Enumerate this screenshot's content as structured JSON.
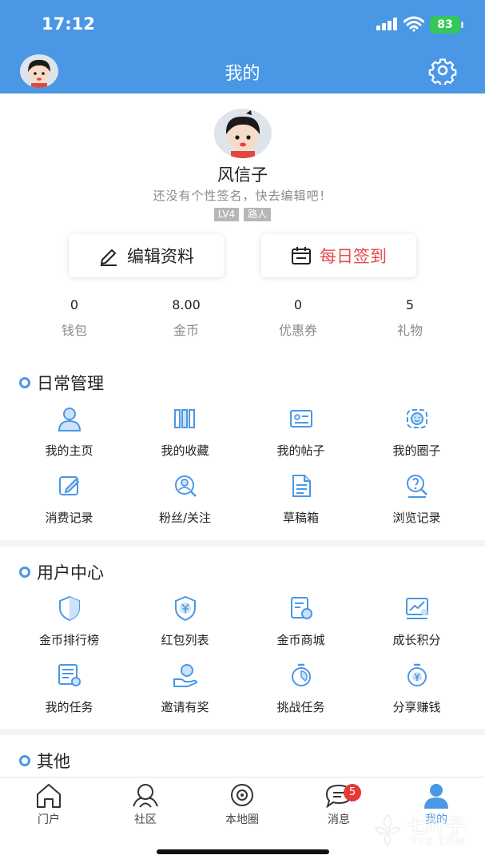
{
  "status_bar": {
    "time": "17:12",
    "battery": "83"
  },
  "nav": {
    "title": "我的",
    "avatar_icon": "cartoon-avatar",
    "settings_icon": "gear-icon"
  },
  "profile": {
    "name": "风信子",
    "signature": "还没有个性签名，快去编辑吧！",
    "level": "LV4",
    "rank": "路人"
  },
  "actions": {
    "edit_label": "编辑资料",
    "signin_label": "每日签到"
  },
  "stats": [
    {
      "value": "0",
      "label": "钱包"
    },
    {
      "value": "8.00",
      "label": "金币"
    },
    {
      "value": "0",
      "label": "优惠券"
    },
    {
      "value": "5",
      "label": "礼物"
    }
  ],
  "sections": {
    "daily": {
      "title": "日常管理",
      "items": [
        {
          "label": "我的主页",
          "icon": "user-icon"
        },
        {
          "label": "我的收藏",
          "icon": "books-icon"
        },
        {
          "label": "我的帖子",
          "icon": "id-card-icon"
        },
        {
          "label": "我的圈子",
          "icon": "smile-face-icon"
        },
        {
          "label": "消费记录",
          "icon": "edit-note-icon"
        },
        {
          "label": "粉丝/关注",
          "icon": "user-search-icon"
        },
        {
          "label": "草稿箱",
          "icon": "document-icon"
        },
        {
          "label": "浏览记录",
          "icon": "search-bulb-icon"
        }
      ]
    },
    "user_center": {
      "title": "用户中心",
      "items": [
        {
          "label": "金币排行榜",
          "icon": "shield-icon"
        },
        {
          "label": "红包列表",
          "icon": "yuan-shield-icon"
        },
        {
          "label": "金币商城",
          "icon": "store-coin-icon"
        },
        {
          "label": "成长积分",
          "icon": "chart-card-icon"
        },
        {
          "label": "我的任务",
          "icon": "task-list-icon"
        },
        {
          "label": "邀请有奖",
          "icon": "gift-hand-icon"
        },
        {
          "label": "挑战任务",
          "icon": "stopwatch-icon"
        },
        {
          "label": "分享赚钱",
          "icon": "coin-timer-icon"
        }
      ]
    },
    "other": {
      "title": "其他"
    }
  },
  "tabbar": [
    {
      "label": "门户",
      "icon": "home-icon"
    },
    {
      "label": "社区",
      "icon": "community-icon"
    },
    {
      "label": "本地圈",
      "icon": "local-circle-icon"
    },
    {
      "label": "消息",
      "icon": "chat-icon",
      "badge": "5"
    },
    {
      "label": "我的",
      "icon": "profile-icon",
      "active": true
    }
  ],
  "watermark": {
    "text": "七叶子",
    "sub": "7YZ.COM"
  },
  "colors": {
    "accent": "#4a97e6",
    "signin": "#e54b4b",
    "badge": "#e53935"
  }
}
